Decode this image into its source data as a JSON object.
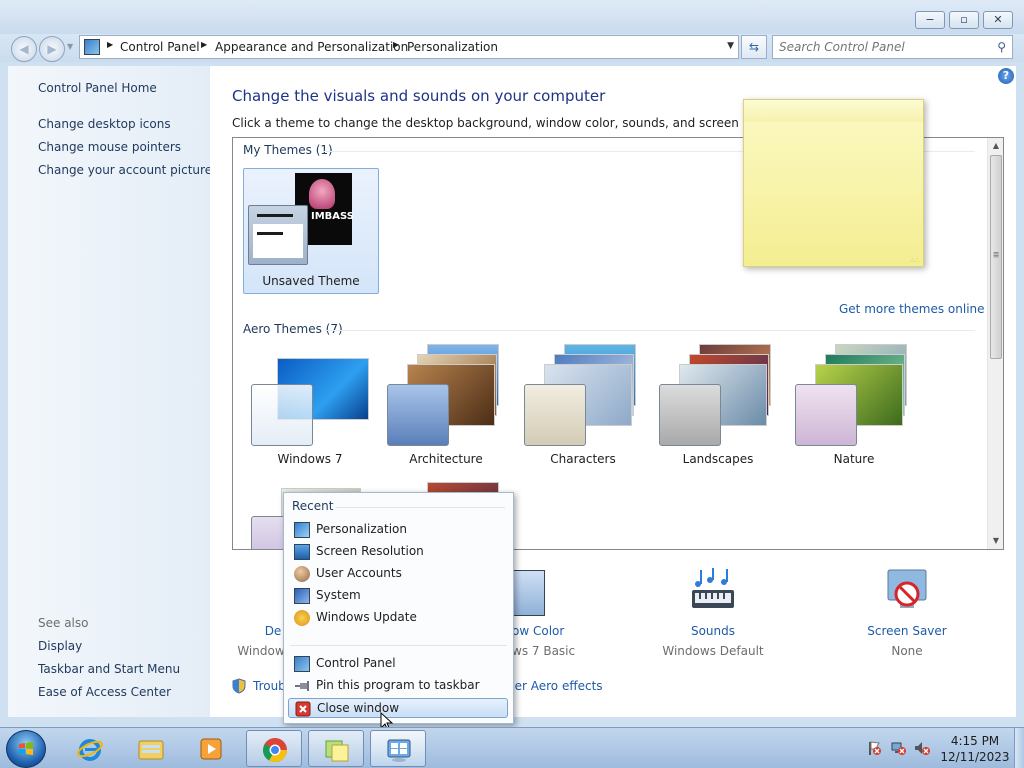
{
  "window": {
    "min_glyph": "−",
    "max_glyph": "▫",
    "close_glyph": "✕"
  },
  "address": {
    "crumbs": [
      "Control Panel",
      "Appearance and Personalization",
      "Personalization"
    ]
  },
  "search": {
    "placeholder": "Search Control Panel"
  },
  "sidebar": {
    "home": "Control Panel Home",
    "links": [
      "Change desktop icons",
      "Change mouse pointers",
      "Change your account picture"
    ],
    "see_also_label": "See also",
    "see_also": [
      "Display",
      "Taskbar and Start Menu",
      "Ease of Access Center"
    ]
  },
  "main": {
    "title": "Change the visuals and sounds on your computer",
    "description": "Click a theme to change the desktop background, window color, sounds, and screen saver all at o",
    "my_themes_label": "My Themes (1)",
    "unsaved_theme": "Unsaved Theme",
    "unsaved_logo": "IMBASS",
    "more_themes": "Get more themes online",
    "aero_label": "Aero Themes (7)",
    "aero_themes": [
      "Windows 7",
      "Architecture",
      "Characters",
      "Landscapes",
      "Nature"
    ]
  },
  "settings": {
    "desktop_name": "De",
    "desktop_sub": "Window",
    "color_name": "ow Color",
    "color_sub": "ws 7 Basic",
    "sounds_name": "Sounds",
    "sounds_sub": "Windows Default",
    "saver_name": "Screen Saver",
    "saver_sub": "None",
    "trouble": "Troub",
    "aero_effects": "her Aero effects"
  },
  "jumplist": {
    "recent_label": "Recent",
    "recent": [
      "Personalization",
      "Screen Resolution",
      "User Accounts",
      "System",
      "Windows Update"
    ],
    "tasks": [
      "Control Panel",
      "Pin this program to taskbar",
      "Close window"
    ]
  },
  "tray": {
    "time": "4:15 PM",
    "date": "12/11/2023"
  },
  "colors": {
    "link": "#1e5ba8",
    "title": "#1e3287",
    "sticky": "#f7f2ab"
  }
}
